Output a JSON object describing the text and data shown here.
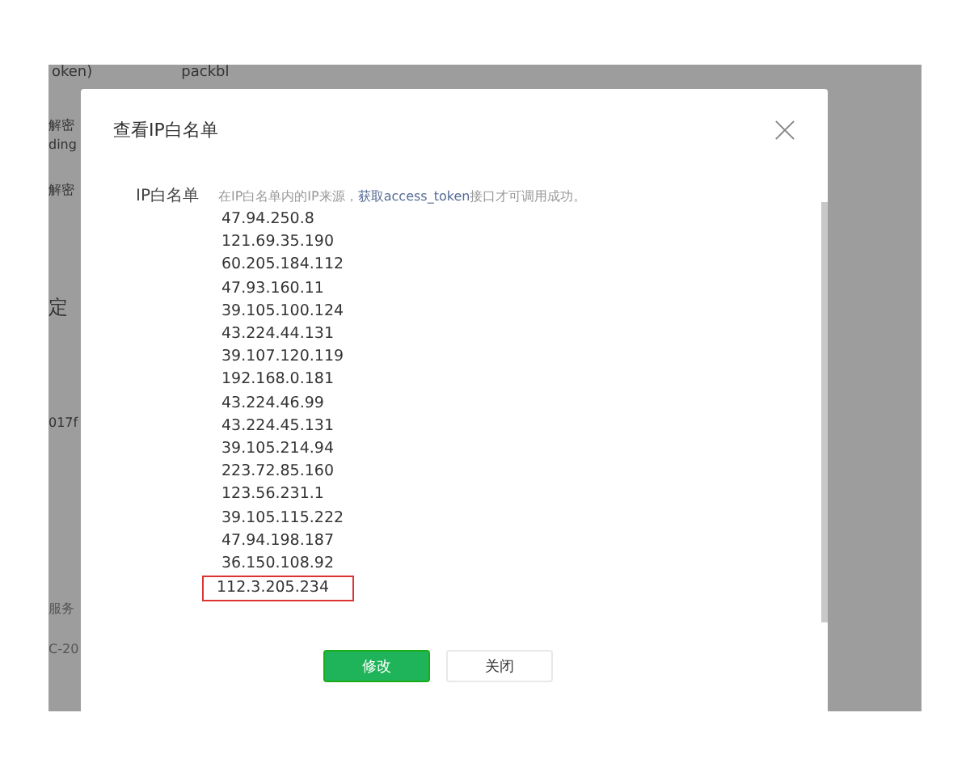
{
  "background_page": {
    "top_fragments": [
      "oken)",
      "packbl"
    ],
    "side_fragments": [
      "解密",
      "ding",
      "解密",
      "定",
      "017f",
      "服务",
      "C-20"
    ]
  },
  "dialog": {
    "title": "查看IP白名单",
    "field_label": "IP白名单",
    "hint_before": "在IP白名单内的IP来源，",
    "hint_link": "获取access_token",
    "hint_after": "接口才可调用成功。",
    "ips": [
      {
        "text": "47.94.250.8",
        "highlighted": false
      },
      {
        "text": "121.69.35.190",
        "highlighted": false
      },
      {
        "text": "60.205.184.112",
        "highlighted": false
      },
      {
        "text": "47.93.160.11",
        "highlighted": false
      },
      {
        "text": "39.105.100.124",
        "highlighted": false
      },
      {
        "text": "43.224.44.131",
        "highlighted": false
      },
      {
        "text": "39.107.120.119",
        "highlighted": false
      },
      {
        "text": "192.168.0.181",
        "highlighted": false
      },
      {
        "text": "43.224.46.99",
        "highlighted": false
      },
      {
        "text": "43.224.45.131",
        "highlighted": false
      },
      {
        "text": "39.105.214.94",
        "highlighted": false
      },
      {
        "text": "223.72.85.160",
        "highlighted": false
      },
      {
        "text": "123.56.231.1",
        "highlighted": false
      },
      {
        "text": "39.105.115.222",
        "highlighted": false
      },
      {
        "text": "47.94.198.187",
        "highlighted": false
      },
      {
        "text": "36.150.108.92",
        "highlighted": false
      },
      {
        "text": "112.3.205.234",
        "highlighted": true
      }
    ],
    "buttons": [
      {
        "label": "修改",
        "kind": "primary"
      },
      {
        "label": "关闭",
        "kind": "default"
      }
    ]
  }
}
